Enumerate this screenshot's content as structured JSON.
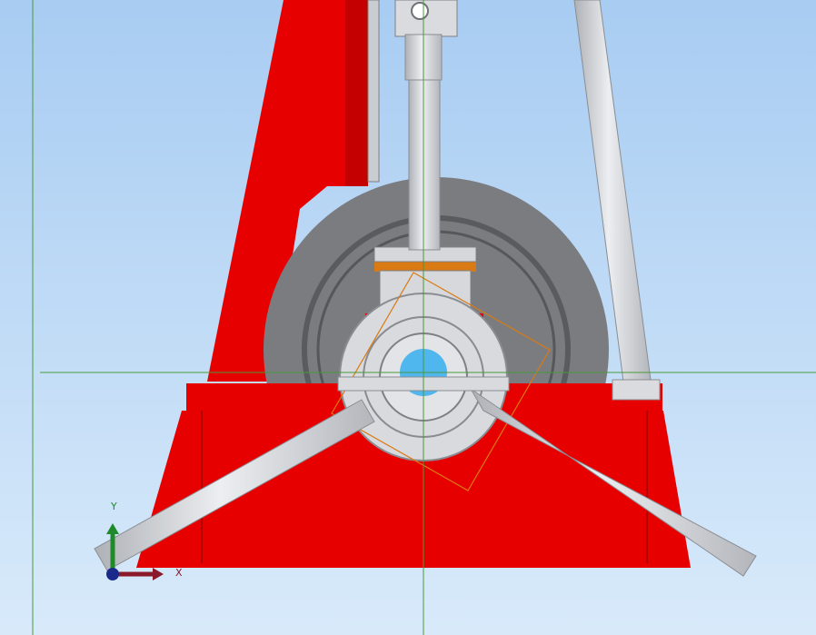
{
  "viewport": {
    "background_top": "#a8ccf2",
    "background_bottom": "#d8eafa"
  },
  "colors": {
    "frame_red": "#e60000",
    "frame_dark_red": "#c40000",
    "shaft_gray": "#d9dbdf",
    "shaft_edge": "#8a8d92",
    "flywheel": "#7b7c80",
    "flywheel_inner": "#c8c9cc",
    "hub_blue": "#4fb7ee",
    "bronze": "#d97a14",
    "construction_line": "#4a9a3a",
    "triad_y": "#1f8a2a",
    "triad_x": "#8a1a2a",
    "triad_origin": "#1a2a8a"
  },
  "triad": {
    "x_label": "X",
    "y_label": "Y"
  }
}
